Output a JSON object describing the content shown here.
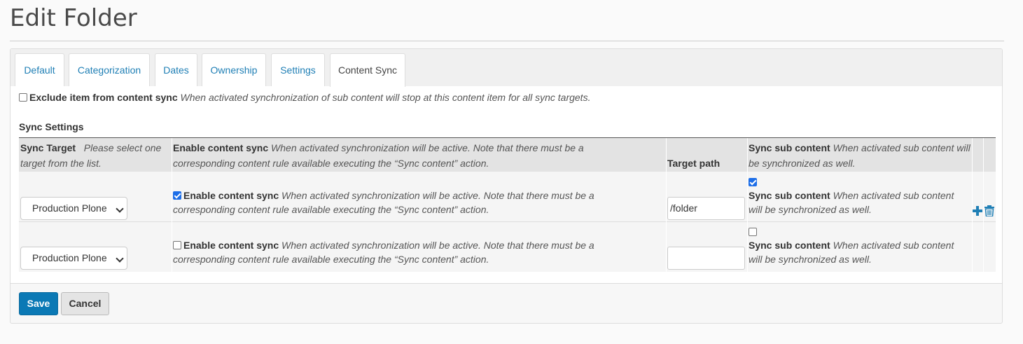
{
  "page": {
    "title": "Edit Folder"
  },
  "tabs": [
    "Default",
    "Categorization",
    "Dates",
    "Ownership",
    "Settings",
    "Content Sync"
  ],
  "active_tab": "Content Sync",
  "exclude": {
    "checked": false,
    "label": "Exclude item from content sync",
    "hint": "When activated synchronization of sub content will stop at this content item for all sync targets."
  },
  "sync_settings": {
    "heading": "Sync Settings",
    "headers": {
      "target_label": "Sync Target",
      "target_hint": "Please select one target from the list.",
      "enable_label": "Enable content sync",
      "enable_hint": "When activated synchronization will be active. Note that there must be a corresponding content rule available executing the “Sync content” action.",
      "path_label": "Target path",
      "sub_label": "Sync sub content",
      "sub_hint": "When activated sub content will be synchronized as well."
    },
    "rows": [
      {
        "target": "Production Plone",
        "enable_checked": true,
        "enable_label": "Enable content sync",
        "enable_hint": "When activated synchronization will be active. Note that there must be a corresponding content rule available executing the “Sync content” action.",
        "path": "/folder",
        "sub_checked": true,
        "sub_label": "Sync sub content",
        "sub_hint": "When activated sub content will be synchronized as well."
      },
      {
        "target": "Production Plone",
        "enable_checked": false,
        "enable_label": "Enable content sync",
        "enable_hint": "When activated synchronization will be active. Note that there must be a corresponding content rule available executing the “Sync content” action.",
        "path": "",
        "sub_checked": false,
        "sub_label": "Sync sub content",
        "sub_hint": "When activated sub content will be synchronized as well."
      }
    ],
    "row_icons": [
      "plus-icon",
      "trash-icon"
    ]
  },
  "buttons": {
    "save": "Save",
    "cancel": "Cancel"
  },
  "colors": {
    "link": "#1f7fb5",
    "primary": "#0b79b5",
    "checkbox": "#1d6ee8"
  }
}
